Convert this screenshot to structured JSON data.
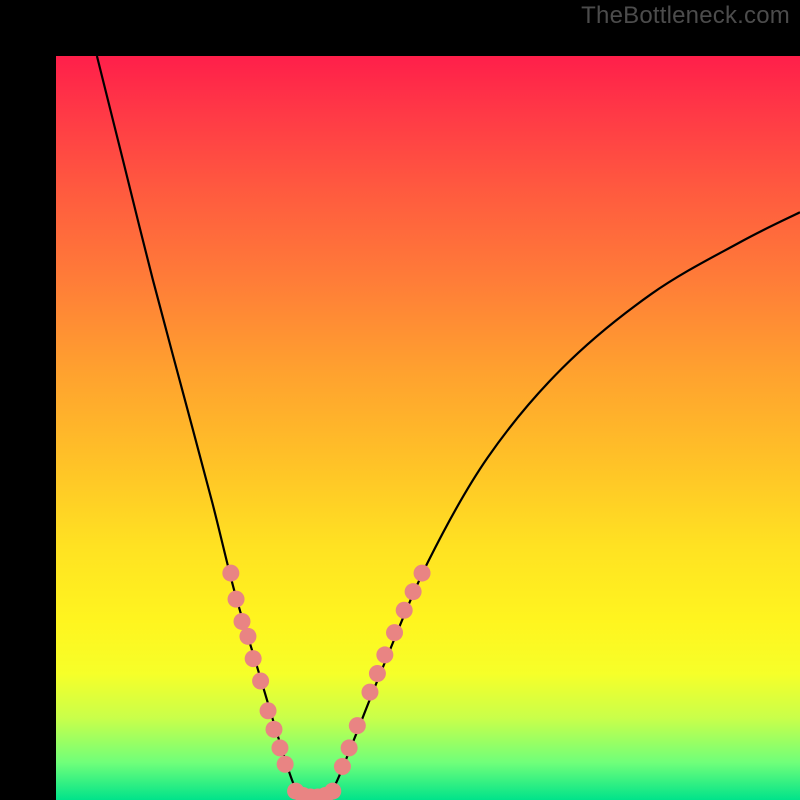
{
  "watermark": "TheBottleneck.com",
  "chart_data": {
    "type": "line",
    "title": "",
    "xlabel": "",
    "ylabel": "",
    "xlim": [
      0,
      100
    ],
    "ylim": [
      0,
      100
    ],
    "curve_points": [
      {
        "x": 5.5,
        "y": 100
      },
      {
        "x": 9,
        "y": 86
      },
      {
        "x": 13,
        "y": 70
      },
      {
        "x": 17,
        "y": 55
      },
      {
        "x": 21,
        "y": 40
      },
      {
        "x": 24,
        "y": 28
      },
      {
        "x": 27,
        "y": 18
      },
      {
        "x": 30,
        "y": 8
      },
      {
        "x": 32,
        "y": 2
      },
      {
        "x": 33.5,
        "y": 0.3
      },
      {
        "x": 36,
        "y": 0.3
      },
      {
        "x": 37.5,
        "y": 2
      },
      {
        "x": 40,
        "y": 8
      },
      {
        "x": 44,
        "y": 18
      },
      {
        "x": 50,
        "y": 32
      },
      {
        "x": 58,
        "y": 46
      },
      {
        "x": 68,
        "y": 58
      },
      {
        "x": 80,
        "y": 68
      },
      {
        "x": 92,
        "y": 75
      },
      {
        "x": 100,
        "y": 79
      }
    ],
    "markers_left": [
      {
        "x": 23.5,
        "y": 30.5
      },
      {
        "x": 24.2,
        "y": 27
      },
      {
        "x": 25.0,
        "y": 24
      },
      {
        "x": 25.8,
        "y": 22
      },
      {
        "x": 26.5,
        "y": 19
      },
      {
        "x": 27.5,
        "y": 16
      },
      {
        "x": 28.5,
        "y": 12
      },
      {
        "x": 29.3,
        "y": 9.5
      },
      {
        "x": 30.1,
        "y": 7
      },
      {
        "x": 30.8,
        "y": 4.8
      }
    ],
    "markers_bottom": [
      {
        "x": 32.2,
        "y": 1.2
      },
      {
        "x": 33.2,
        "y": 0.6
      },
      {
        "x": 34.2,
        "y": 0.4
      },
      {
        "x": 35.2,
        "y": 0.4
      },
      {
        "x": 36.2,
        "y": 0.6
      },
      {
        "x": 37.2,
        "y": 1.2
      }
    ],
    "markers_right": [
      {
        "x": 38.5,
        "y": 4.5
      },
      {
        "x": 39.4,
        "y": 7
      },
      {
        "x": 40.5,
        "y": 10
      },
      {
        "x": 42.2,
        "y": 14.5
      },
      {
        "x": 43.2,
        "y": 17
      },
      {
        "x": 44.2,
        "y": 19.5
      },
      {
        "x": 45.5,
        "y": 22.5
      },
      {
        "x": 46.8,
        "y": 25.5
      },
      {
        "x": 48.0,
        "y": 28
      },
      {
        "x": 49.2,
        "y": 30.5
      }
    ],
    "marker_color": "#e98483",
    "curve_color": "#000000"
  }
}
